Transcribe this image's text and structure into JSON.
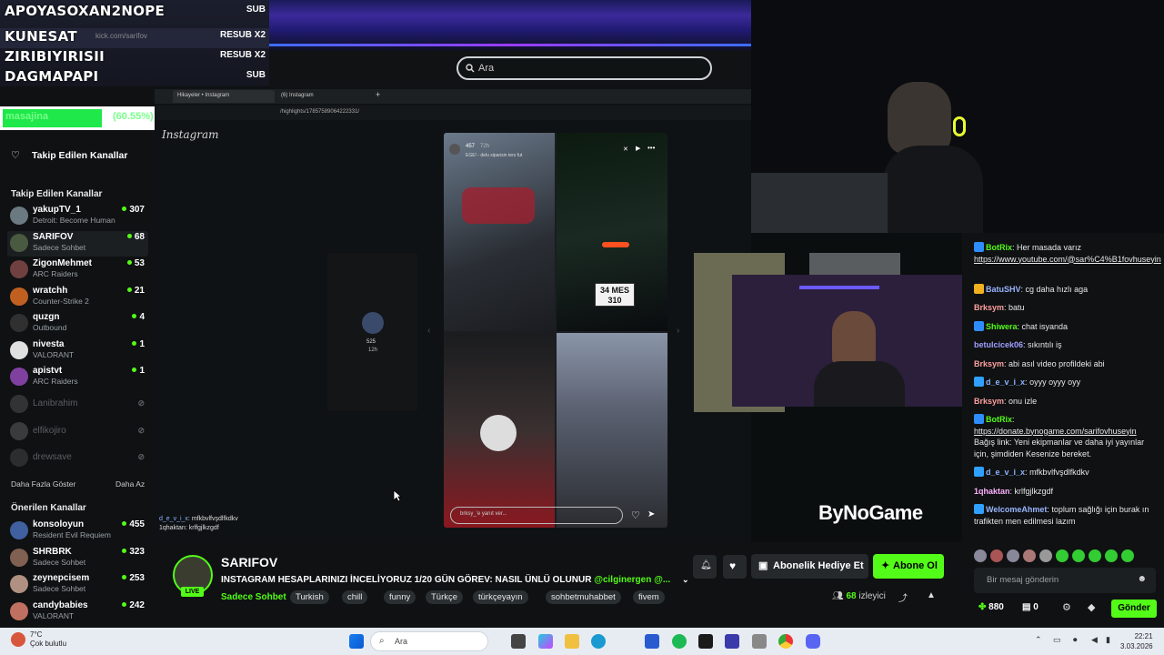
{
  "overlay": {
    "rows": [
      {
        "name": "APOYASOXAN2NOPE",
        "tag": "SUB"
      },
      {
        "name": "KUNESAT",
        "tag": "RESUB X2"
      },
      {
        "name": "ZIRIBIYIRISII",
        "tag": "RESUB X2"
      },
      {
        "name": "DAGMAPAPI",
        "tag": "SUB"
      }
    ],
    "url_hint": "kick.com/sarifov",
    "progress_label": "masajina",
    "progress_pct": "(60.55%)",
    "progress_value": 0.6055
  },
  "browser": {
    "search_placeholder": "Ara",
    "tabs": [
      "Hikayeler • Instagram",
      "(6) Instagram"
    ],
    "url": "/highlights/17857589064222331/",
    "ig_logo": "Instagram",
    "story_count": "457",
    "story_time": "72h",
    "story_caption": "EGE! - delu siparisin ters fut",
    "side_story_count": "525",
    "side_story_time": "12h",
    "reply_placeholder": "brksy_'e yanıt ver...",
    "plate": "34 MES 310",
    "sponsor": "ByNoGame"
  },
  "stream_chat": [
    {
      "user": "d_e_v_i_x",
      "text": "mfkbvlfvşdlfkdkv"
    },
    {
      "user": "1qhaktan",
      "text": "krlfgjlkzgdf"
    }
  ],
  "sidebar": {
    "followed_button": "Takip Edilen Kanallar",
    "followed_title": "Takip Edilen Kanallar",
    "channels": [
      {
        "name": "yakupTV_1",
        "game": "Detroit: Become Human",
        "viewers": "307",
        "color": "#6a7a80"
      },
      {
        "name": "SARIFOV",
        "game": "Sadece Sohbet",
        "viewers": "68",
        "color": "#4a5a40"
      },
      {
        "name": "ZigonMehmet",
        "game": "ARC Raiders",
        "viewers": "53",
        "color": "#704040"
      },
      {
        "name": "wratchh",
        "game": "Counter-Strike 2",
        "viewers": "21",
        "color": "#c06020"
      },
      {
        "name": "quzgn",
        "game": "Outbound",
        "viewers": "4",
        "color": "#303030"
      },
      {
        "name": "nivesta",
        "game": "VALORANT",
        "viewers": "1",
        "color": "#e0e0e0"
      },
      {
        "name": "apistvt",
        "game": "ARC Raiders",
        "viewers": "1",
        "color": "#8040a0"
      }
    ],
    "offline": [
      {
        "name": "Lanibrahim",
        "color": "#555"
      },
      {
        "name": "elfikojiro",
        "color": "#666"
      },
      {
        "name": "drewsave",
        "color": "#4a4a4a"
      }
    ],
    "show_more": "Daha Fazla Göster",
    "show_less": "Daha Az",
    "recommended_title": "Önerilen Kanallar",
    "recommended": [
      {
        "name": "konsoloyun",
        "game": "Resident Evil Requiem",
        "viewers": "455",
        "color": "#4060a0"
      },
      {
        "name": "SHRBRK",
        "game": "Sadece Sohbet",
        "viewers": "323",
        "color": "#806050"
      },
      {
        "name": "zeynepcisem",
        "game": "Sadece Sohbet",
        "viewers": "253",
        "color": "#b09080"
      },
      {
        "name": "candybabies",
        "game": "VALORANT",
        "viewers": "242",
        "color": "#c07060"
      }
    ]
  },
  "streamer": {
    "name": "SARIFOV",
    "live": "LIVE",
    "title": "INSTAGRAM HESAPLARINIZI İNCELİYORUZ 1/20 GÜN GÖREV: NASIL ÜNLÜ OLUNUR",
    "mention": "@cilginergen @...",
    "category": "Sadece Sohbet",
    "tags": [
      "Turkish",
      "chill",
      "funny",
      "Türkçe",
      "türkçeyayın",
      "sohbetmuhabbet",
      "fivem"
    ],
    "gift_label": "Abonelik Hediye Et",
    "sub_label": "Abone Ol",
    "viewers": "68",
    "viewers_label": "izleyici"
  },
  "chat": {
    "messages": [
      {
        "user": "BotRix",
        "text": "Her masada varız",
        "link": "https://www.youtube.com/@sar%C4%B1fovhuseyin",
        "ucolor": "#53fc18",
        "badge": "#2f8cff"
      },
      {
        "user": "BatuSHV",
        "text": "cg daha hızlı aga",
        "ucolor": "#9ab5ff",
        "badge": "#f0b020"
      },
      {
        "user": "Brksym",
        "text": "batu",
        "ucolor": "#ffa0a0"
      },
      {
        "user": "Shiwera",
        "text": "chat isyanda",
        "ucolor": "#53fc18",
        "badge": "#2f8cff"
      },
      {
        "user": "betulcicek06",
        "text": "sıkıntılı iş",
        "ucolor": "#a0a0ff"
      },
      {
        "user": "Brksym",
        "text": "abi asıl video profildeki abi",
        "ucolor": "#ffa0a0"
      },
      {
        "user": "d_e_v_i_x",
        "text": "oyyy oyyy oyy",
        "ucolor": "#8ab4ff",
        "badge": "#2fa0ff"
      },
      {
        "user": "Brksym",
        "text": "onu izle",
        "ucolor": "#ffa0a0"
      },
      {
        "user": "BotRix",
        "text": "",
        "link": "https://donate.bynogame.com/sarifovhuseyin",
        "extra": "Bağış link: Yeni ekipmanlar ve daha iyi yayınlar için, şimdiden Kesenize bereket.",
        "ucolor": "#53fc18",
        "badge": "#2f8cff"
      },
      {
        "user": "d_e_v_i_x",
        "text": "mfkbvlfvşdlfkdkv",
        "ucolor": "#8ab4ff",
        "badge": "#2fa0ff"
      },
      {
        "user": "1qhaktan",
        "text": "krlfgjlkzgdf",
        "ucolor": "#ffb0ff"
      },
      {
        "user": "WelcomeAhmet",
        "text": "toplum sağlığı için burak ın trafikten men edilmesi lazım",
        "ucolor": "#9ab5ff",
        "badge": "#2fa0ff"
      }
    ],
    "input_placeholder": "Bir mesaj gönderin",
    "points": "880",
    "count": "0",
    "send_label": "Gönder"
  },
  "taskbar": {
    "temp": "7°C",
    "weather": "Çok bulutlu",
    "search_placeholder": "Ara",
    "time": "22:21",
    "date": "3.03.2026"
  }
}
